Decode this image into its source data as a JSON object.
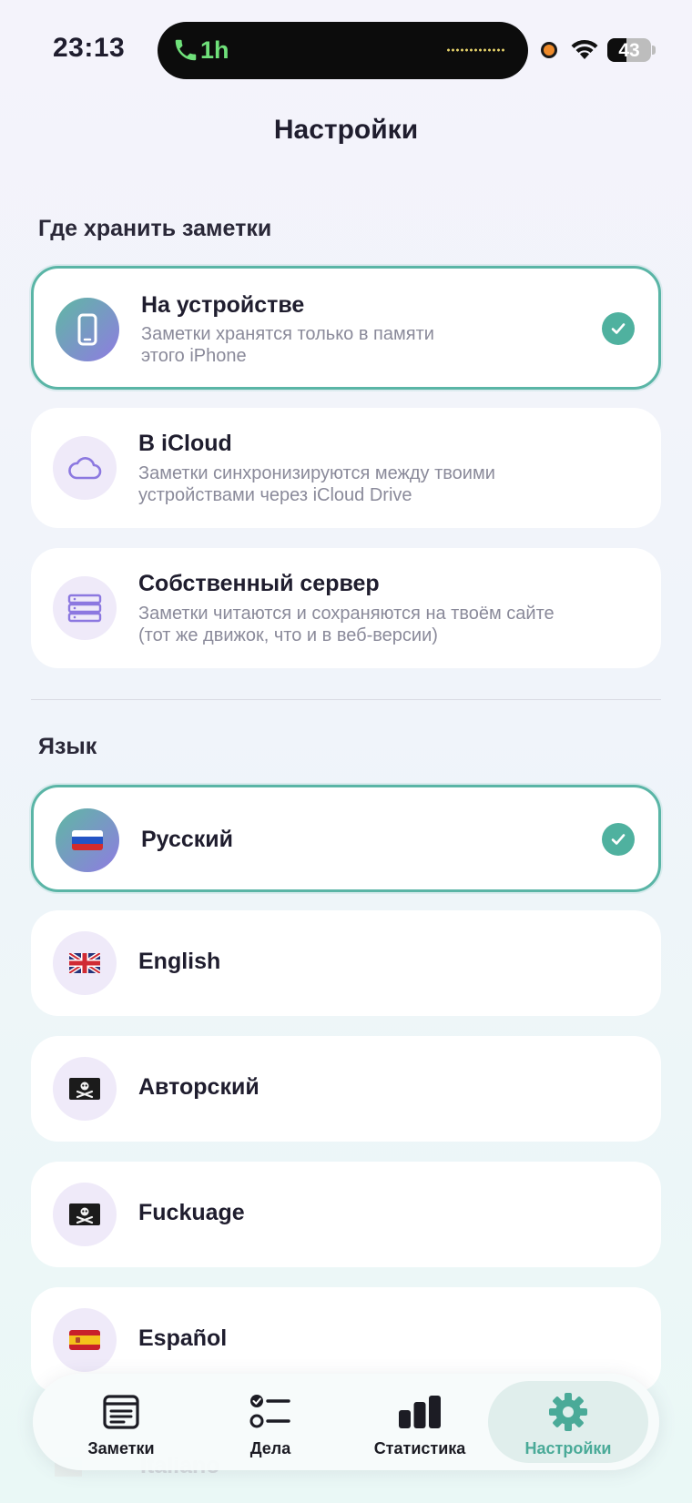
{
  "status_bar": {
    "time": "23:13",
    "call_duration": "1h",
    "battery_percent": "43",
    "battery_level": 0.43
  },
  "header": {
    "title": "Настройки"
  },
  "storage": {
    "section_title": "Где хранить заметки",
    "options": [
      {
        "title": "На устройстве",
        "description_line1": "Заметки хранятся только в памяти",
        "description_line2": "этого iPhone",
        "icon": "phone-icon",
        "selected": true
      },
      {
        "title": "В iCloud",
        "description_line1": "Заметки синхронизируются между твоими",
        "description_line2": "устройствами через iCloud Drive",
        "icon": "cloud-icon",
        "selected": false
      },
      {
        "title": "Собственный сервер",
        "description_line1": "Заметки читаются и сохраняются на твоём сайте",
        "description_line2": "(тот же движок, что и в веб-версии)",
        "icon": "server-icon",
        "selected": false
      }
    ]
  },
  "language": {
    "section_title": "Язык",
    "options": [
      {
        "label": "Русский",
        "flag": "russia-flag",
        "selected": true
      },
      {
        "label": "English",
        "flag": "uk-flag",
        "selected": false
      },
      {
        "label": "Авторский",
        "flag": "pirate-flag",
        "selected": false
      },
      {
        "label": "Fuckuage",
        "flag": "pirate-flag",
        "selected": false
      },
      {
        "label": "Español",
        "flag": "spain-flag",
        "selected": false
      },
      {
        "label": "Italiano",
        "flag": "italy-flag",
        "selected": false
      }
    ]
  },
  "tabbar": {
    "tabs": [
      {
        "label": "Заметки",
        "icon": "notes-icon",
        "active": false
      },
      {
        "label": "Дела",
        "icon": "checklist-icon",
        "active": false
      },
      {
        "label": "Статистика",
        "icon": "bar-chart-icon",
        "active": false
      },
      {
        "label": "Настройки",
        "icon": "gear-icon",
        "active": true
      }
    ]
  },
  "colors": {
    "accent": "#4fb19f",
    "selected_border": "#5ab5a6",
    "icon_gradient_start": "#5fb8a3",
    "icon_gradient_end": "#8f7be2",
    "icon_purple": "#8c78e0"
  }
}
